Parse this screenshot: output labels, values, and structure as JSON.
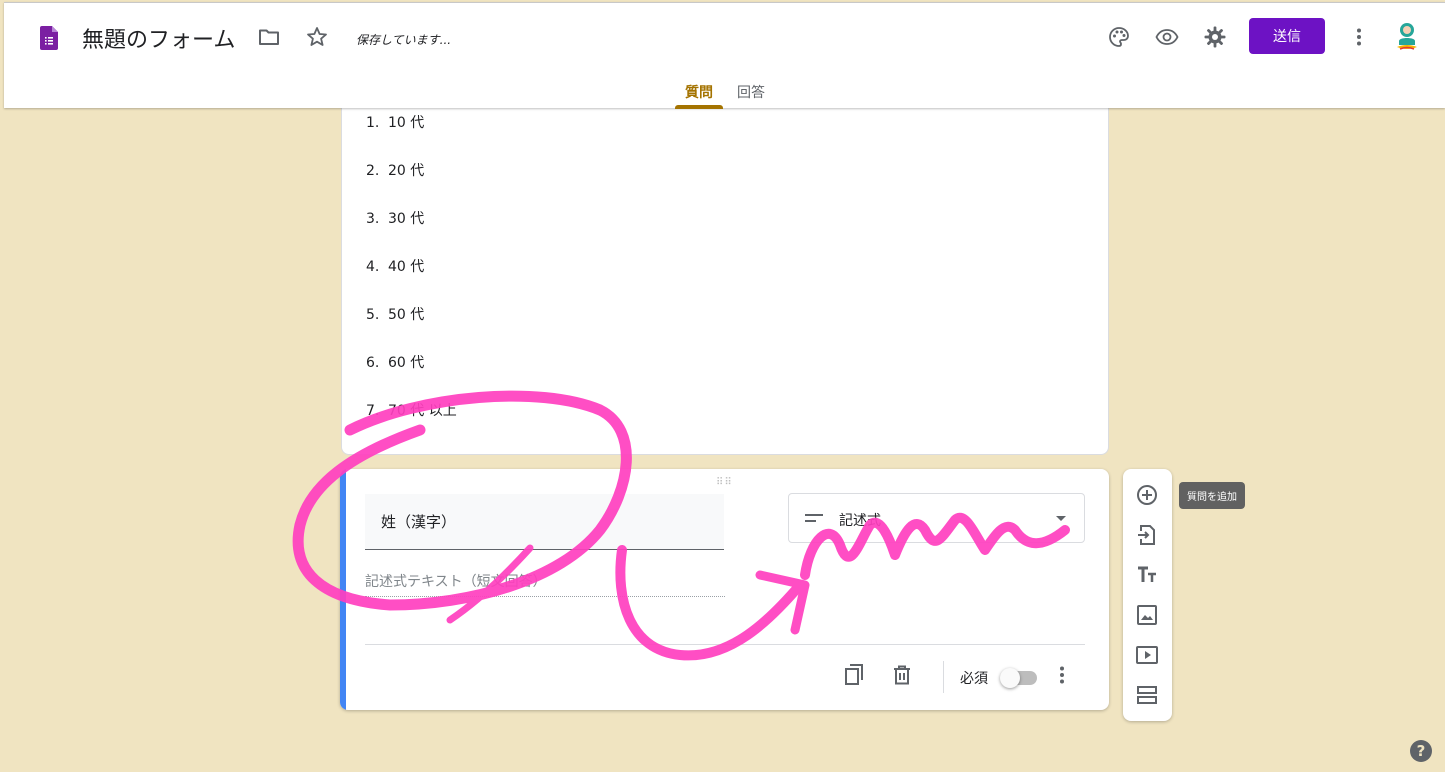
{
  "header": {
    "title": "無題のフォーム",
    "saving_status": "保存しています...",
    "send_label": "送信",
    "icons": [
      "forms-logo-icon",
      "folder-icon",
      "star-icon",
      "palette-icon",
      "eye-icon",
      "gear-icon",
      "more-vert-icon"
    ],
    "accent_color": "#6d12c4"
  },
  "tabs": {
    "questions": "質問",
    "responses": "回答",
    "active": "質問"
  },
  "question1": {
    "options": [
      {
        "num": "1.",
        "label": "10 代"
      },
      {
        "num": "2.",
        "label": "20 代"
      },
      {
        "num": "3.",
        "label": "30 代"
      },
      {
        "num": "4.",
        "label": "40 代"
      },
      {
        "num": "5.",
        "label": "50 代"
      },
      {
        "num": "6.",
        "label": "60 代"
      },
      {
        "num": "7.",
        "label": "70 代 以上"
      }
    ]
  },
  "question2": {
    "title": "姓（漢字）",
    "type_label": "記述式",
    "answer_placeholder": "記述式テキスト（短文回答）",
    "required_label": "必須",
    "required": false
  },
  "toolbar": {
    "tooltip": "質問を追加",
    "icons": [
      "add-circle-icon",
      "import-icon",
      "title-icon",
      "image-icon",
      "video-icon",
      "section-icon"
    ]
  },
  "colors": {
    "background": "#f0e4c1",
    "tab_active": "#a47300",
    "card_accent": "#4285f4",
    "annotation": "#ff3fbf"
  }
}
